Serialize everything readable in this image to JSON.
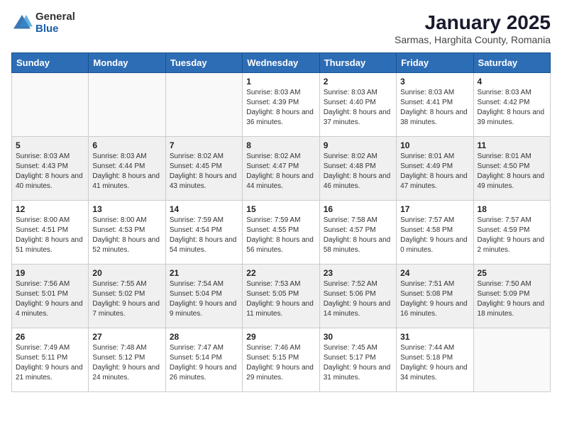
{
  "logo": {
    "general": "General",
    "blue": "Blue"
  },
  "title": "January 2025",
  "subtitle": "Sarmas, Harghita County, Romania",
  "days_of_week": [
    "Sunday",
    "Monday",
    "Tuesday",
    "Wednesday",
    "Thursday",
    "Friday",
    "Saturday"
  ],
  "weeks": [
    [
      {
        "day": "",
        "info": ""
      },
      {
        "day": "",
        "info": ""
      },
      {
        "day": "",
        "info": ""
      },
      {
        "day": "1",
        "info": "Sunrise: 8:03 AM\nSunset: 4:39 PM\nDaylight: 8 hours and 36 minutes."
      },
      {
        "day": "2",
        "info": "Sunrise: 8:03 AM\nSunset: 4:40 PM\nDaylight: 8 hours and 37 minutes."
      },
      {
        "day": "3",
        "info": "Sunrise: 8:03 AM\nSunset: 4:41 PM\nDaylight: 8 hours and 38 minutes."
      },
      {
        "day": "4",
        "info": "Sunrise: 8:03 AM\nSunset: 4:42 PM\nDaylight: 8 hours and 39 minutes."
      }
    ],
    [
      {
        "day": "5",
        "info": "Sunrise: 8:03 AM\nSunset: 4:43 PM\nDaylight: 8 hours and 40 minutes."
      },
      {
        "day": "6",
        "info": "Sunrise: 8:03 AM\nSunset: 4:44 PM\nDaylight: 8 hours and 41 minutes."
      },
      {
        "day": "7",
        "info": "Sunrise: 8:02 AM\nSunset: 4:45 PM\nDaylight: 8 hours and 43 minutes."
      },
      {
        "day": "8",
        "info": "Sunrise: 8:02 AM\nSunset: 4:47 PM\nDaylight: 8 hours and 44 minutes."
      },
      {
        "day": "9",
        "info": "Sunrise: 8:02 AM\nSunset: 4:48 PM\nDaylight: 8 hours and 46 minutes."
      },
      {
        "day": "10",
        "info": "Sunrise: 8:01 AM\nSunset: 4:49 PM\nDaylight: 8 hours and 47 minutes."
      },
      {
        "day": "11",
        "info": "Sunrise: 8:01 AM\nSunset: 4:50 PM\nDaylight: 8 hours and 49 minutes."
      }
    ],
    [
      {
        "day": "12",
        "info": "Sunrise: 8:00 AM\nSunset: 4:51 PM\nDaylight: 8 hours and 51 minutes."
      },
      {
        "day": "13",
        "info": "Sunrise: 8:00 AM\nSunset: 4:53 PM\nDaylight: 8 hours and 52 minutes."
      },
      {
        "day": "14",
        "info": "Sunrise: 7:59 AM\nSunset: 4:54 PM\nDaylight: 8 hours and 54 minutes."
      },
      {
        "day": "15",
        "info": "Sunrise: 7:59 AM\nSunset: 4:55 PM\nDaylight: 8 hours and 56 minutes."
      },
      {
        "day": "16",
        "info": "Sunrise: 7:58 AM\nSunset: 4:57 PM\nDaylight: 8 hours and 58 minutes."
      },
      {
        "day": "17",
        "info": "Sunrise: 7:57 AM\nSunset: 4:58 PM\nDaylight: 9 hours and 0 minutes."
      },
      {
        "day": "18",
        "info": "Sunrise: 7:57 AM\nSunset: 4:59 PM\nDaylight: 9 hours and 2 minutes."
      }
    ],
    [
      {
        "day": "19",
        "info": "Sunrise: 7:56 AM\nSunset: 5:01 PM\nDaylight: 9 hours and 4 minutes."
      },
      {
        "day": "20",
        "info": "Sunrise: 7:55 AM\nSunset: 5:02 PM\nDaylight: 9 hours and 7 minutes."
      },
      {
        "day": "21",
        "info": "Sunrise: 7:54 AM\nSunset: 5:04 PM\nDaylight: 9 hours and 9 minutes."
      },
      {
        "day": "22",
        "info": "Sunrise: 7:53 AM\nSunset: 5:05 PM\nDaylight: 9 hours and 11 minutes."
      },
      {
        "day": "23",
        "info": "Sunrise: 7:52 AM\nSunset: 5:06 PM\nDaylight: 9 hours and 14 minutes."
      },
      {
        "day": "24",
        "info": "Sunrise: 7:51 AM\nSunset: 5:08 PM\nDaylight: 9 hours and 16 minutes."
      },
      {
        "day": "25",
        "info": "Sunrise: 7:50 AM\nSunset: 5:09 PM\nDaylight: 9 hours and 18 minutes."
      }
    ],
    [
      {
        "day": "26",
        "info": "Sunrise: 7:49 AM\nSunset: 5:11 PM\nDaylight: 9 hours and 21 minutes."
      },
      {
        "day": "27",
        "info": "Sunrise: 7:48 AM\nSunset: 5:12 PM\nDaylight: 9 hours and 24 minutes."
      },
      {
        "day": "28",
        "info": "Sunrise: 7:47 AM\nSunset: 5:14 PM\nDaylight: 9 hours and 26 minutes."
      },
      {
        "day": "29",
        "info": "Sunrise: 7:46 AM\nSunset: 5:15 PM\nDaylight: 9 hours and 29 minutes."
      },
      {
        "day": "30",
        "info": "Sunrise: 7:45 AM\nSunset: 5:17 PM\nDaylight: 9 hours and 31 minutes."
      },
      {
        "day": "31",
        "info": "Sunrise: 7:44 AM\nSunset: 5:18 PM\nDaylight: 9 hours and 34 minutes."
      },
      {
        "day": "",
        "info": ""
      }
    ]
  ]
}
